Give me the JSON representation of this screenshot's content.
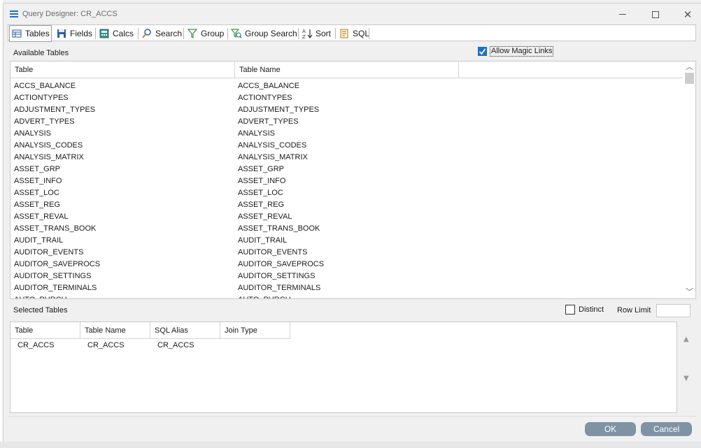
{
  "window": {
    "title": "Query Designer: CR_ACCS"
  },
  "toolbar": {
    "tabs": [
      {
        "label": "Tables",
        "icon": "table-icon"
      },
      {
        "label": "Fields",
        "icon": "floppy-disk-icon"
      },
      {
        "label": "Calcs",
        "icon": "calculator-icon"
      },
      {
        "label": "Search",
        "icon": "magnifier-icon"
      },
      {
        "label": "Group",
        "icon": "funnel-icon"
      },
      {
        "label": "Group Search",
        "icon": "funnel-search-icon"
      },
      {
        "label": "Sort",
        "icon": "sort-az-icon"
      },
      {
        "label": "SQL",
        "icon": "sql-script-icon"
      }
    ]
  },
  "available": {
    "label": "Available Tables",
    "allow_magic_links_label": "Allow Magic Links",
    "allow_magic_links_checked": true,
    "columns": [
      "Table",
      "Table Name"
    ],
    "rows": [
      [
        "ACCS_BALANCE",
        "ACCS_BALANCE"
      ],
      [
        "ACTIONTYPES",
        "ACTIONTYPES"
      ],
      [
        "ADJUSTMENT_TYPES",
        "ADJUSTMENT_TYPES"
      ],
      [
        "ADVERT_TYPES",
        "ADVERT_TYPES"
      ],
      [
        "ANALYSIS",
        "ANALYSIS"
      ],
      [
        "ANALYSIS_CODES",
        "ANALYSIS_CODES"
      ],
      [
        "ANALYSIS_MATRIX",
        "ANALYSIS_MATRIX"
      ],
      [
        "ASSET_GRP",
        "ASSET_GRP"
      ],
      [
        "ASSET_INFO",
        "ASSET_INFO"
      ],
      [
        "ASSET_LOC",
        "ASSET_LOC"
      ],
      [
        "ASSET_REG",
        "ASSET_REG"
      ],
      [
        "ASSET_REVAL",
        "ASSET_REVAL"
      ],
      [
        "ASSET_TRANS_BOOK",
        "ASSET_TRANS_BOOK"
      ],
      [
        "AUDIT_TRAIL",
        "AUDIT_TRAIL"
      ],
      [
        "AUDITOR_EVENTS",
        "AUDITOR_EVENTS"
      ],
      [
        "AUDITOR_SAVEPROCS",
        "AUDITOR_SAVEPROCS"
      ],
      [
        "AUDITOR_SETTINGS",
        "AUDITOR_SETTINGS"
      ],
      [
        "AUDITOR_TERMINALS",
        "AUDITOR_TERMINALS"
      ],
      [
        "AUTO_PURCH",
        "AUTO_PURCH"
      ]
    ]
  },
  "selected": {
    "label": "Selected Tables",
    "distinct_label": "Distinct",
    "distinct_checked": false,
    "row_limit_label": "Row Limit",
    "row_limit_value": "",
    "columns": [
      "Table",
      "Table Name",
      "SQL Alias",
      "Join Type"
    ],
    "rows": [
      [
        "CR_ACCS",
        "CR_ACCS",
        "CR_ACCS",
        ""
      ]
    ]
  },
  "buttons": {
    "ok": "OK",
    "cancel": "Cancel"
  },
  "colors": {
    "accent": "#1f6fc5",
    "button": "#7f93a5"
  }
}
